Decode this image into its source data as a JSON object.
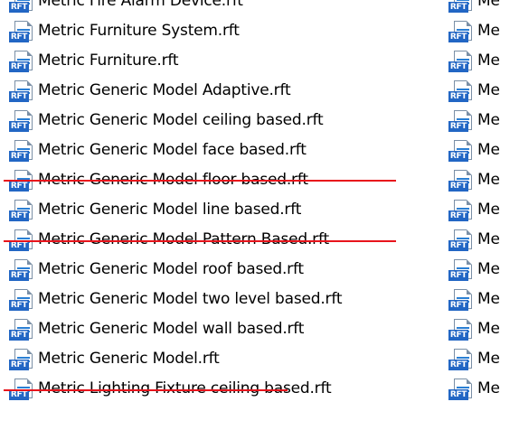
{
  "icon_badge": "RFT",
  "annotation_color": "#e8141c",
  "left_column": [
    {
      "name": "Metric Fire Alarm Device.rft"
    },
    {
      "name": "Metric Furniture System.rft"
    },
    {
      "name": "Metric Furniture.rft"
    },
    {
      "name": "Metric Generic Model Adaptive.rft"
    },
    {
      "name": "Metric Generic Model ceiling based.rft"
    },
    {
      "name": "Metric Generic Model face based.rft",
      "underlined": true
    },
    {
      "name": "Metric Generic Model floor based.rft"
    },
    {
      "name": "Metric Generic Model line based.rft",
      "underlined": true
    },
    {
      "name": "Metric Generic Model Pattern Based.rft"
    },
    {
      "name": "Metric Generic Model roof based.rft"
    },
    {
      "name": "Metric Generic Model two level based.rft"
    },
    {
      "name": "Metric Generic Model wall based.rft"
    },
    {
      "name": "Metric Generic Model.rft",
      "underlined": true
    },
    {
      "name": "Metric Lighting Fixture ceiling based.rft"
    }
  ],
  "right_column": [
    {
      "name": "Me"
    },
    {
      "name": "Me"
    },
    {
      "name": "Me"
    },
    {
      "name": "Me"
    },
    {
      "name": "Me"
    },
    {
      "name": "Me"
    },
    {
      "name": "Me"
    },
    {
      "name": "Me"
    },
    {
      "name": "Me"
    },
    {
      "name": "Me"
    },
    {
      "name": "Me"
    },
    {
      "name": "Me"
    },
    {
      "name": "Me"
    },
    {
      "name": "Me"
    }
  ]
}
